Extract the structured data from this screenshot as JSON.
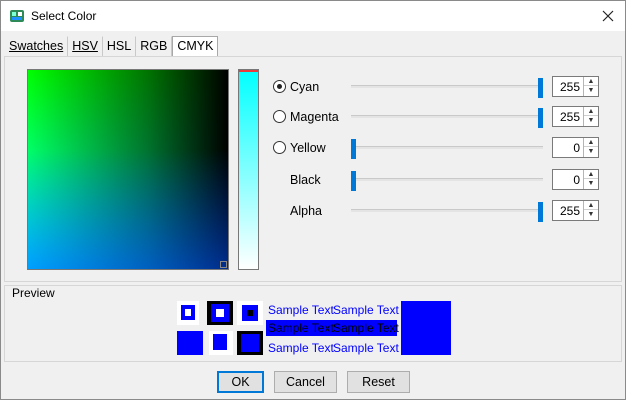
{
  "window": {
    "title": "Select Color",
    "icon": "color-palette-icon",
    "close_icon": "close-icon"
  },
  "tabs": [
    {
      "label": "Swatches",
      "active": false
    },
    {
      "label": "HSV",
      "active": false
    },
    {
      "label": "HSL",
      "active": false
    },
    {
      "label": "RGB",
      "active": false
    },
    {
      "label": "CMYK",
      "active": true
    }
  ],
  "channels": [
    {
      "label": "Cyan",
      "radio": true,
      "selected": true,
      "value": "255",
      "level": 1.0
    },
    {
      "label": "Magenta",
      "radio": true,
      "selected": false,
      "value": "255",
      "level": 1.0
    },
    {
      "label": "Yellow",
      "radio": true,
      "selected": false,
      "value": "0",
      "level": 0.0
    },
    {
      "label": "Black",
      "radio": false,
      "selected": false,
      "value": "0",
      "level": 0.0
    },
    {
      "label": "Alpha",
      "radio": false,
      "selected": false,
      "value": "255",
      "level": 1.0
    }
  ],
  "preview": {
    "label": "Preview",
    "sample_text": "Sample Text",
    "color": "#0000ff"
  },
  "buttons": {
    "ok": "OK",
    "cancel": "Cancel",
    "reset": "Reset"
  },
  "colors": {
    "accent": "#0078d7",
    "selected_color": "#0000ff"
  }
}
